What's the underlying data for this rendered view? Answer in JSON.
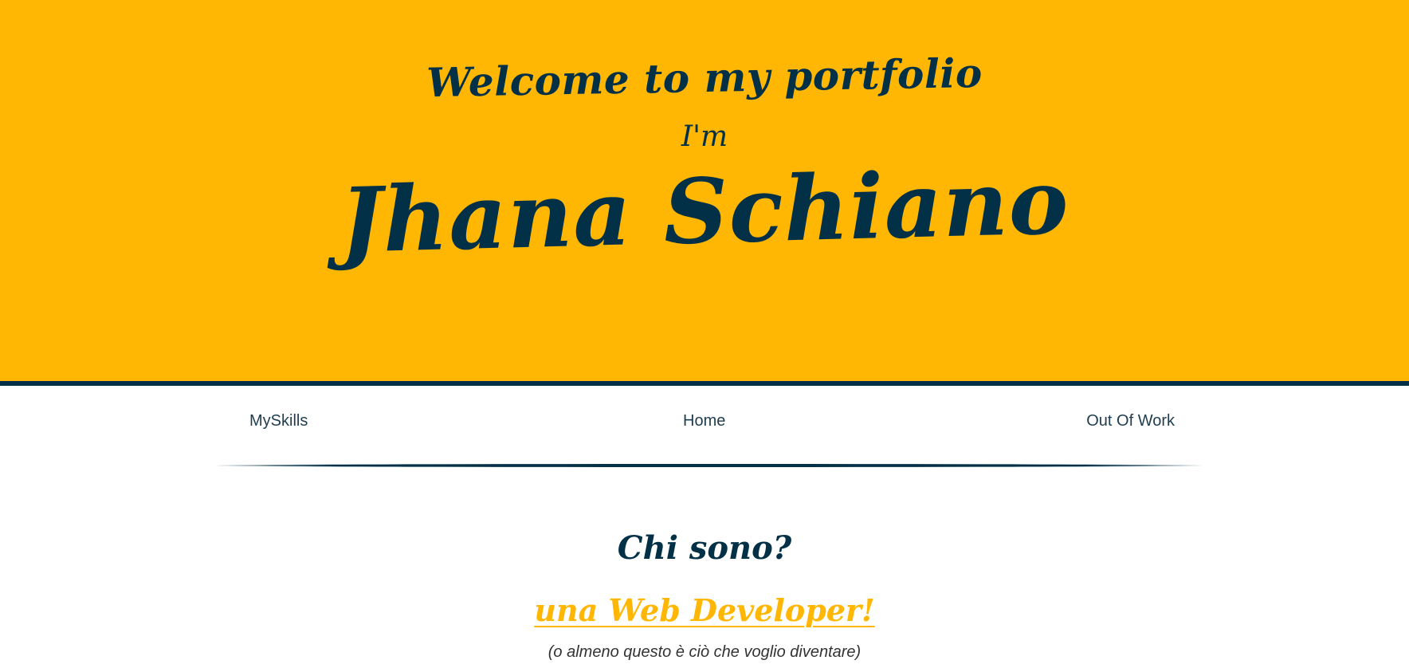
{
  "colors": {
    "accent": "#ffb703",
    "primary": "#023047",
    "background": "#ffffff"
  },
  "hero": {
    "welcome": "Welcome to my portfolio",
    "intro": "I'm",
    "name": "Jhana Schiano"
  },
  "nav": {
    "items": [
      {
        "label": "MySkills"
      },
      {
        "label": "Home"
      },
      {
        "label": "Out Of Work"
      }
    ]
  },
  "about": {
    "title": "Chi sono?",
    "role": "una Web Developer!",
    "note": "(o almeno questo è ciò che voglio diventare)"
  }
}
